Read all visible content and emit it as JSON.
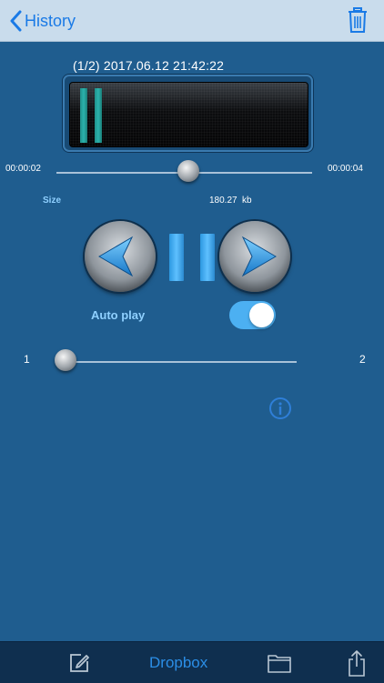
{
  "nav": {
    "back_label": "History"
  },
  "recording": {
    "title": "(1/2) 2017.06.12 21:42:22"
  },
  "meter": {
    "left_level": 1,
    "right_level": 1
  },
  "playback": {
    "time_current": "00:00:02",
    "time_total": "00:00:04",
    "progress": 0.5
  },
  "size": {
    "label": "Size",
    "value": "180.27",
    "unit": "kb"
  },
  "autoplay": {
    "label": "Auto play",
    "on": true
  },
  "pager": {
    "min": "1",
    "max": "2",
    "position": 0
  },
  "toolbar": {
    "dropbox_label": "Dropbox"
  },
  "icons": {
    "back": "chevron-left-icon",
    "trash": "trash-icon",
    "prev": "prev-arrow-icon",
    "pause": "pause-icon",
    "next": "next-arrow-icon",
    "info": "info-icon",
    "compose": "compose-icon",
    "folder": "folder-icon",
    "share": "share-icon"
  },
  "colors": {
    "background": "#1f5d8f",
    "accent": "#1a7ae6",
    "toggle_on": "#4cb0f2",
    "toolbar": "#0f2f4f"
  }
}
